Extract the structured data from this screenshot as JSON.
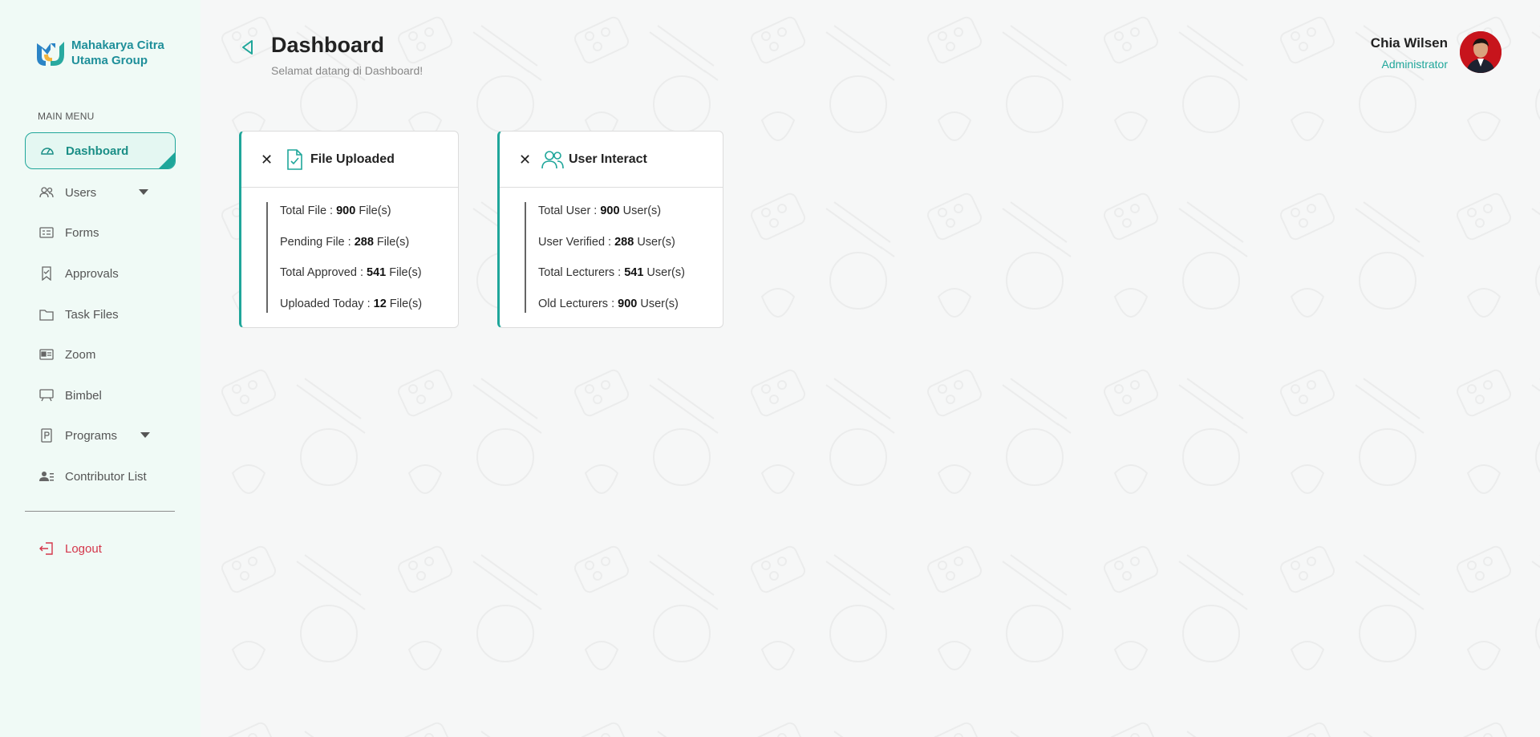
{
  "brand": {
    "line1": "Mahakarya Citra",
    "line2": "Utama Group"
  },
  "sidebar": {
    "menu_title": "MAIN MENU",
    "items": [
      {
        "label": "Dashboard",
        "icon": "gauge-icon",
        "active": true
      },
      {
        "label": "Users",
        "icon": "users-icon",
        "has_submenu": true
      },
      {
        "label": "Forms",
        "icon": "form-icon"
      },
      {
        "label": "Approvals",
        "icon": "bookmark-check-icon"
      },
      {
        "label": "Task Files",
        "icon": "folder-icon"
      },
      {
        "label": "Zoom",
        "icon": "id-card-icon"
      },
      {
        "label": "Bimbel",
        "icon": "presentation-board-icon"
      },
      {
        "label": "Programs",
        "icon": "document-p-icon",
        "has_submenu": true
      },
      {
        "label": "Contributor List",
        "icon": "user-list-icon"
      }
    ],
    "logout_label": "Logout"
  },
  "header": {
    "title": "Dashboard",
    "subtitle": "Selamat datang di Dashboard!",
    "user_name": "Chia Wilsen",
    "user_role": "Administrator"
  },
  "cards": [
    {
      "title": "File Uploaded",
      "icon": "file-check-icon",
      "stats": [
        {
          "label": "Total File : ",
          "value": "900",
          "unit": " File(s)"
        },
        {
          "label": "Pending File : ",
          "value": "288",
          "unit": " File(s)"
        },
        {
          "label": "Total Approved : ",
          "value": "541",
          "unit": " File(s)"
        },
        {
          "label": "Uploaded Today : ",
          "value": "12",
          "unit": " File(s)"
        }
      ]
    },
    {
      "title": "User Interact",
      "icon": "users-icon",
      "stats": [
        {
          "label": "Total User : ",
          "value": "900",
          "unit": " User(s)"
        },
        {
          "label": "User Verified : ",
          "value": "288",
          "unit": " User(s)"
        },
        {
          "label": "Total Lecturers : ",
          "value": "541",
          "unit": " User(s)"
        },
        {
          "label": "Old Lecturers : ",
          "value": "900",
          "unit": " User(s)"
        }
      ]
    }
  ],
  "colors": {
    "accent": "#1fa69a",
    "brand": "#1f8f9a",
    "logout": "#d4364a",
    "sidebar_bg": "#f0faf6"
  }
}
